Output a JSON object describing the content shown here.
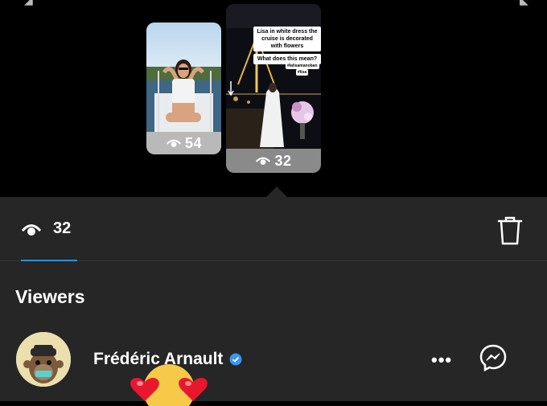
{
  "stories": [
    {
      "views": "54"
    },
    {
      "views": "32",
      "caption": "Lisa in white dress the cruise is decorated with flowers",
      "question": "What does this mean?",
      "tag1": "#lalisamanoban",
      "tag2": "#lisa"
    }
  ],
  "stats": {
    "view_count": "32"
  },
  "viewers": {
    "title": "Viewers",
    "items": [
      {
        "name": "Frédéric Arnault"
      }
    ]
  },
  "colors": {
    "sheet_bg": "#262626",
    "accent": "#2f8fd6",
    "verified": "#3897f0"
  }
}
